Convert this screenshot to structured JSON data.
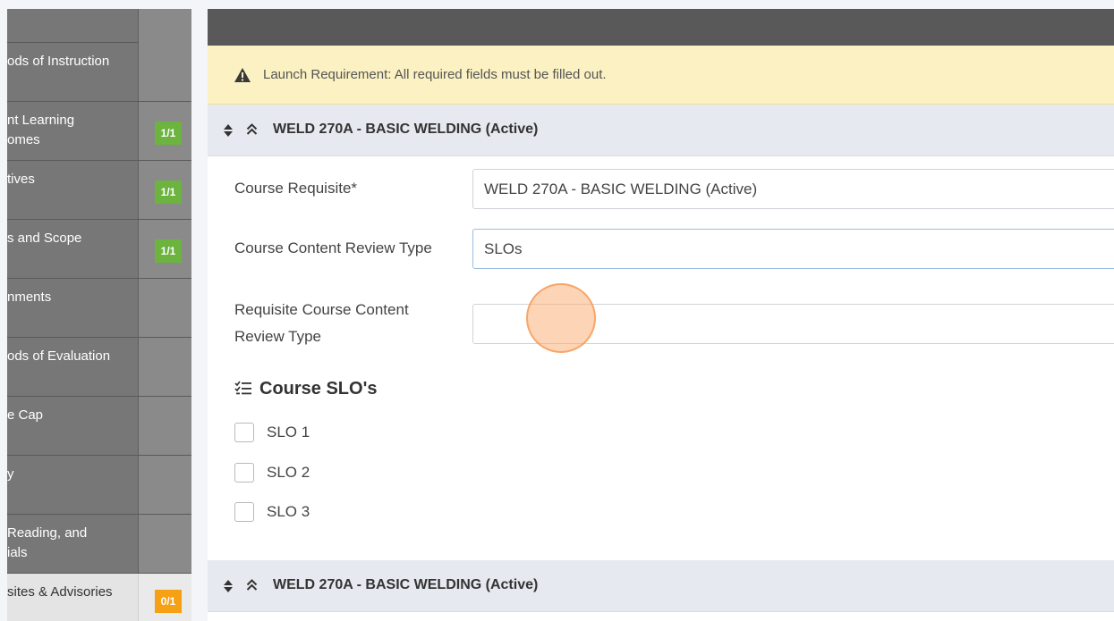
{
  "sidebar": {
    "items": [
      {
        "label": "ods of Instruction",
        "badge": ""
      },
      {
        "label": "nt Learning\nomes",
        "badge": "1/1"
      },
      {
        "label": "tives",
        "badge": "1/1"
      },
      {
        "label": "s and Scope",
        "badge": "1/1"
      },
      {
        "label": "nments",
        "badge": ""
      },
      {
        "label": "ods of Evaluation",
        "badge": ""
      },
      {
        "label": "e Cap",
        "badge": ""
      },
      {
        "label": "y",
        "badge": ""
      },
      {
        "label": "Reading, and\nials",
        "badge": ""
      },
      {
        "label": "sites & Advisories",
        "badge": "0/1"
      }
    ]
  },
  "alert": {
    "text": "Launch Requirement: All required fields must be filled out."
  },
  "sections": [
    {
      "title": "WELD 270A - BASIC WELDING (Active)"
    },
    {
      "title": "WELD 270A - BASIC WELDING (Active)"
    }
  ],
  "form": {
    "course_requisite_label": "Course Requisite*",
    "course_requisite_value": "WELD 270A - BASIC WELDING (Active)",
    "review_type_label": "Course Content Review Type",
    "review_type_value": "SLOs",
    "req_review_type_label": "Requisite Course Content\nReview Type",
    "req_review_type_value": ""
  },
  "slo": {
    "heading": "Course SLO's",
    "items": [
      {
        "label": "SLO 1",
        "checked": false
      },
      {
        "label": "SLO 2",
        "checked": false
      },
      {
        "label": "SLO 3",
        "checked": false
      }
    ]
  },
  "colors": {
    "sidebar_bg": "#777777",
    "badge_green": "#6cb33f",
    "badge_orange": "#f5a015",
    "alert_bg": "#fbf1c2",
    "topbar_bg": "#595959"
  }
}
